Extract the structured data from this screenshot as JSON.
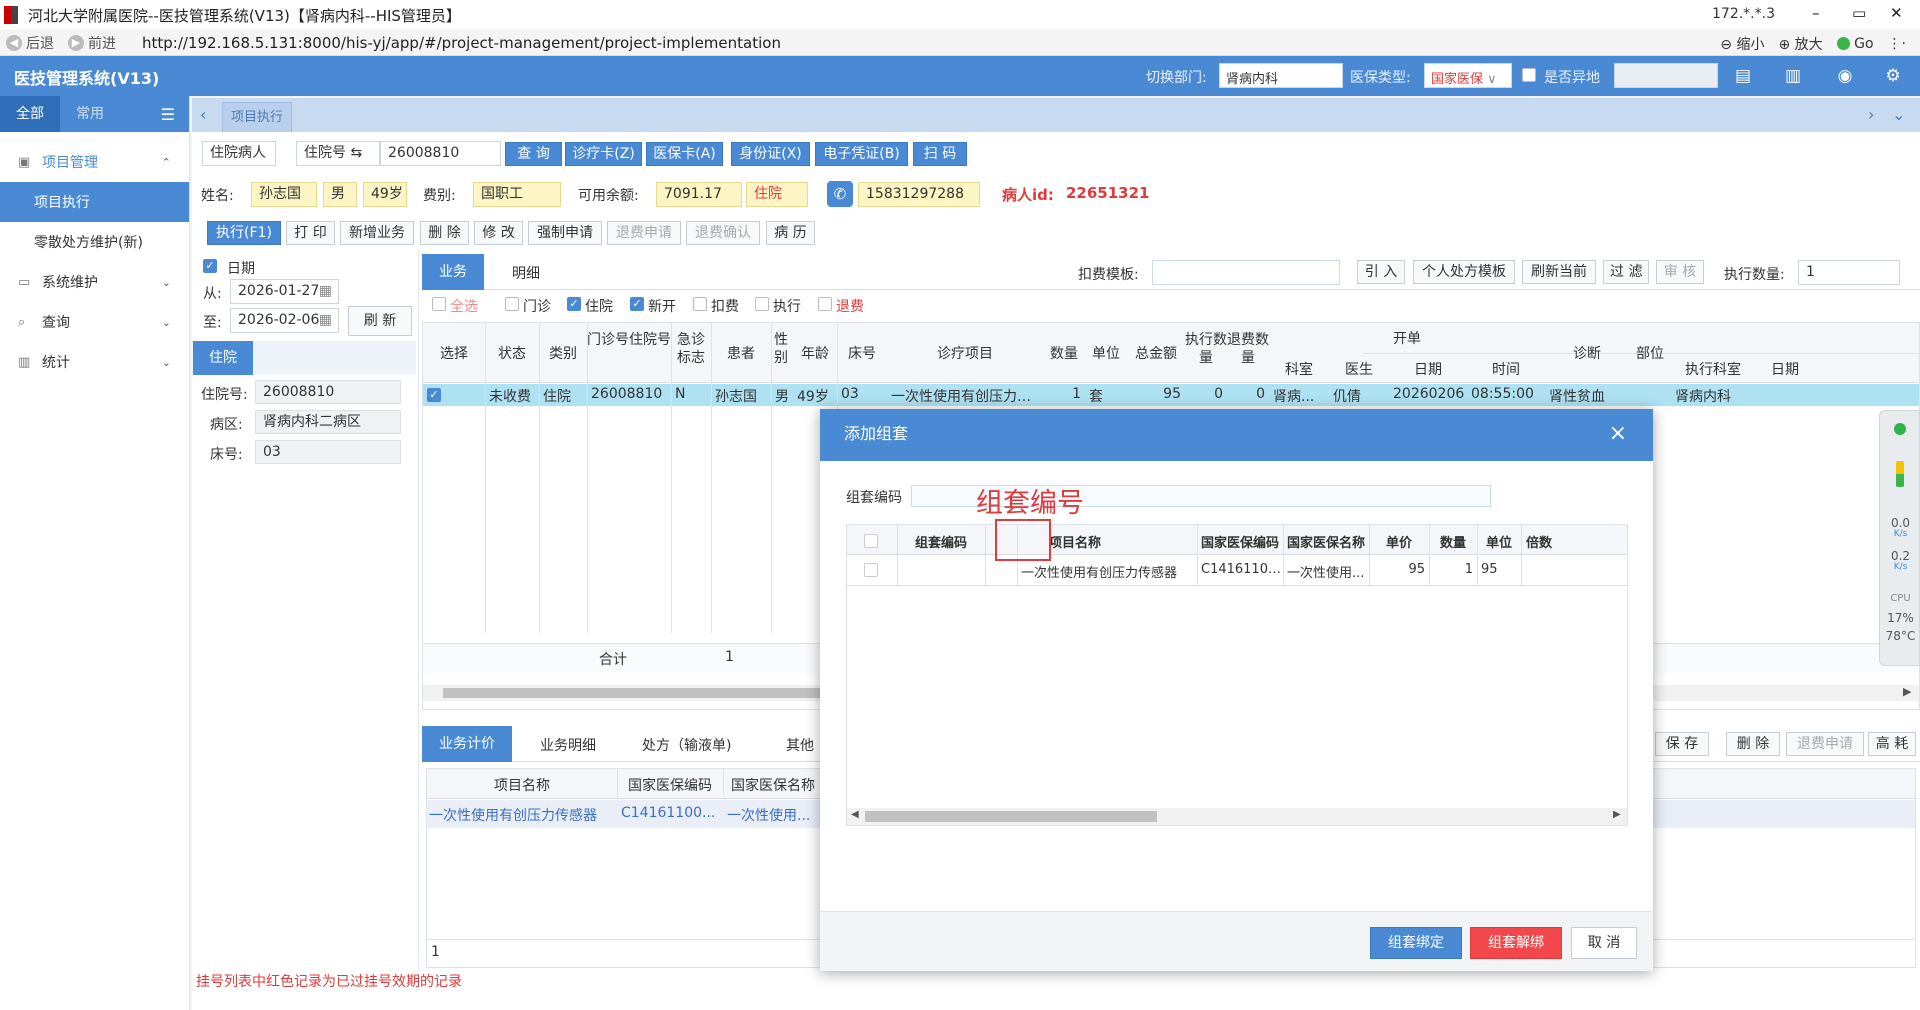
{
  "window": {
    "title": "河北大学附属医院--医技管理系统(V13)【肾病内科--HIS管理员】",
    "ip": "172.*.*.3",
    "controls": [
      "–",
      "▭",
      "✕"
    ]
  },
  "address_bar": {
    "back": "后退",
    "forward": "前进",
    "url": "http://192.168.5.131:8000/his-yj/app/#/project-management/project-implementation",
    "zoom_out": "缩小",
    "zoom_in": "放大",
    "go": "Go"
  },
  "header": {
    "app_name": "医技管理系统(V13)",
    "dept_label": "切换部门:",
    "dept_value": "肾病内科",
    "insurance_label": "医保类型:",
    "insurance_value": "国家医保",
    "remote_label": "是否异地",
    "icons": [
      "card-icon",
      "document-icon",
      "eye-icon",
      "gear-icon"
    ]
  },
  "sidebar": {
    "tabs": [
      "全部",
      "常用"
    ],
    "items": [
      {
        "label": "项目管理",
        "icon": "project-icon",
        "chevron": "⌃"
      },
      {
        "label": "项目执行",
        "sub": true,
        "active": true
      },
      {
        "label": "零散处方维护(新)",
        "sub": true
      },
      {
        "label": "系统维护",
        "icon": "system-icon",
        "chevron": "⌄"
      },
      {
        "label": "查询",
        "icon": "query-icon",
        "chevron": "⌄"
      },
      {
        "label": "统计",
        "icon": "stats-icon",
        "chevron": "⌄"
      }
    ]
  },
  "page_tab": "项目执行",
  "search": {
    "patient_type": "住院病人",
    "id_type": "住院号 ⇆",
    "id_value": "26008810",
    "buttons": [
      "查 询",
      "诊疗卡(Z)",
      "医保卡(A)",
      "身份证(X)",
      "电子凭证(B)",
      "扫 码"
    ]
  },
  "patient": {
    "name_label": "姓名:",
    "name": "孙志国",
    "sex": "男",
    "age": "49岁",
    "category_label": "费别:",
    "category": "国职工",
    "balance_label": "可用余额:",
    "balance": "7091.17",
    "status": "住院",
    "phone": "15831297288",
    "pid_label": "病人id:",
    "pid": "22651321"
  },
  "toolbar": [
    "执行(F1)",
    "打 印",
    "新增业务",
    "删 除",
    "修 改",
    "强制申请",
    "退费申请",
    "退费确认",
    "病 历"
  ],
  "date_filter": {
    "label": "日期",
    "from_label": "从:",
    "from": "2026-01-27",
    "to_label": "至:",
    "to": "2026-02-06",
    "refresh": "刷 新"
  },
  "inpatient": {
    "section": "住院",
    "id_label": "住院号:",
    "id": "26008810",
    "ward_label": "病区:",
    "ward": "肾病内科二病区",
    "bed_label": "床号:",
    "bed": "03"
  },
  "upper_tabs": [
    "业务",
    "明细"
  ],
  "charge_template_label": "扣费模板:",
  "upper_buttons": [
    "引 入",
    "个人处方模板",
    "刷新当前",
    "过 滤",
    "审 核"
  ],
  "exec_qty_label": "执行数量:",
  "exec_qty": "1",
  "filters": [
    "全选",
    "门诊",
    "住院",
    "新开",
    "扣费",
    "执行",
    "退费"
  ],
  "main_grid": {
    "headers": [
      "选择",
      "状态",
      "类别",
      "门诊号住院号",
      "急诊标志",
      "患者",
      "性别",
      "年龄",
      "床号",
      "诊疗项目",
      "数量",
      "单位",
      "总金额",
      "执行数量",
      "退费数量",
      "开单",
      "科室",
      "医生",
      "日期",
      "时间",
      "诊断",
      "部位",
      "执行科室",
      "日期"
    ],
    "row": [
      "✓",
      "未收费",
      "住院",
      "26008810",
      "N",
      "孙志国",
      "男",
      "49岁",
      "03",
      "一次性使用有创压力传感器",
      "1",
      "套",
      "95",
      "0",
      "0",
      "肾病...",
      "仉倩",
      "20260206",
      "08:55:00",
      "肾性贫血",
      "",
      "肾病内科"
    ],
    "total_label": "合计",
    "total_value": "1"
  },
  "lower_tabs": [
    "业务计价",
    "业务明细",
    "处方（输液单)",
    "其他"
  ],
  "lower_buttons": [
    "保 存",
    "删 除",
    "退费申请",
    "高 耗"
  ],
  "lower_grid": {
    "headers": [
      "项目名称",
      "国家医保编码",
      "国家医保名称"
    ],
    "row": [
      "一次性使用有创压力传感器",
      "C14161100...",
      "一次性使用..."
    ],
    "footer": "1"
  },
  "note": "挂号列表中红色记录为已过挂号效期的记录",
  "modal": {
    "title": "添加组套",
    "close": "×",
    "code_label": "组套编码",
    "annotation": "组套编号",
    "headers": [
      "组套编码",
      "项目名称",
      "国家医保编码",
      "国家医保名称",
      "单价",
      "数量",
      "单位",
      "倍数"
    ],
    "row": [
      "",
      "一次性使用有创压力传感器",
      "C14161100...",
      "一次性使用...",
      "95",
      "1",
      "95"
    ],
    "buttons": [
      "组套绑定",
      "组套解绑",
      "取 消"
    ]
  },
  "side_widget": {
    "up": "0.0",
    "down": "0.2",
    "unit": "K/s",
    "cpu_label": "CPU",
    "cpu": "17%",
    "temp": "78°C"
  }
}
